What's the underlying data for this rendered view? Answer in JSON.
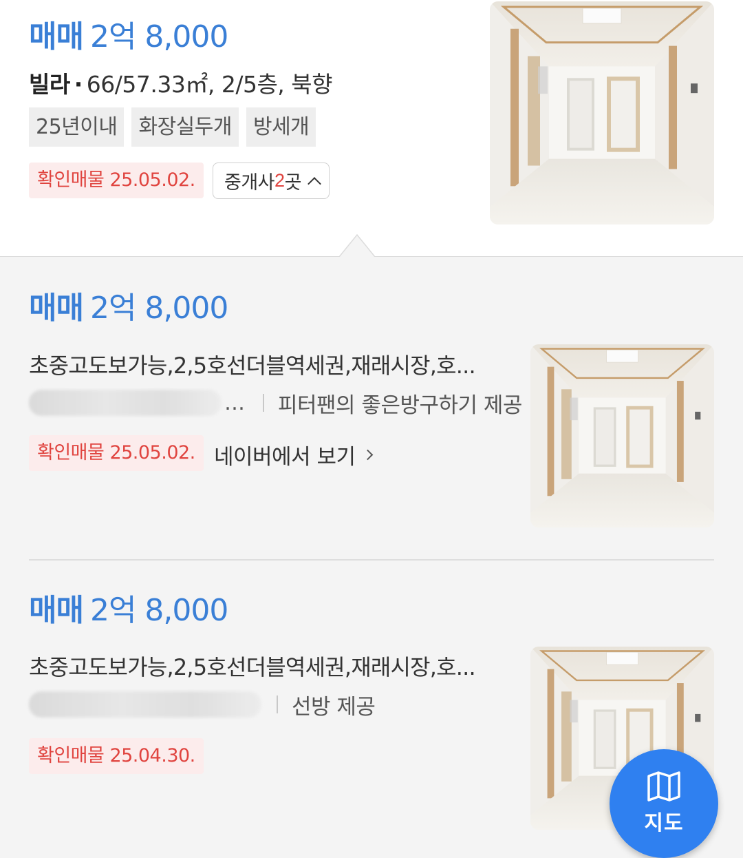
{
  "top_listing": {
    "deal_type": "매매",
    "price": "2억 8,000",
    "property_type": "빌라",
    "details": "66/57.33㎡, 2/5층, 북향",
    "tags": [
      "25년이내",
      "화장실두개",
      "방세개"
    ],
    "verified_label": "확인매물 25.05.02.",
    "broker_button": {
      "prefix": "중개사 ",
      "count": "2",
      "suffix": "곳"
    }
  },
  "sub_listings": [
    {
      "deal_type": "매매",
      "price": "2억 8,000",
      "description": "초중고도보가능,2,5호선더블역세권,재래시장,호...",
      "provider": "피터팬의 좋은방구하기 제공",
      "verified_label": "확인매물 25.05.02.",
      "link_label": "네이버에서 보기"
    },
    {
      "deal_type": "매매",
      "price": "2억 8,000",
      "description": "초중고도보가능,2,5호선더블역세권,재래시장,호...",
      "provider": "선방 제공",
      "verified_label": "확인매물 25.04.30."
    }
  ],
  "map_button": {
    "label": "지도",
    "icon": "map-icon"
  },
  "colors": {
    "accent_blue": "#3a7fd6",
    "verified_red": "#e0443f",
    "verified_bg": "#fcecec",
    "fab_blue": "#2f80f0"
  }
}
